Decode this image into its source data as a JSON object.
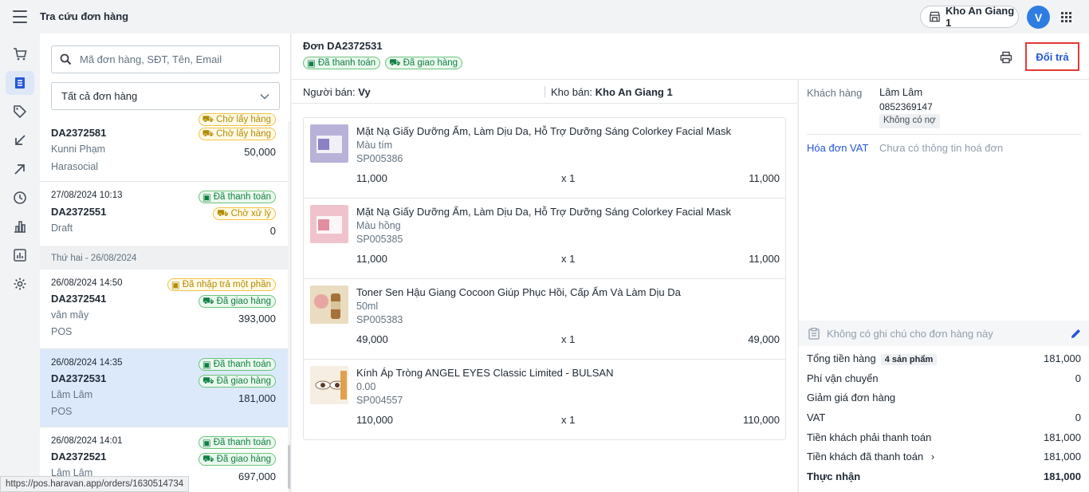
{
  "app": {
    "title": "Tra cứu đơn hàng",
    "store": "Kho An Giang 1",
    "avatar_initial": "V"
  },
  "nav": [
    "cart-icon",
    "orders-icon",
    "tag-icon",
    "import-icon",
    "export-icon",
    "history-icon",
    "chart-icon",
    "report-icon",
    "settings-icon"
  ],
  "list": {
    "search_placeholder": "Mã đơn hàng, SĐT, Tên, Email",
    "filter": "Tất cả đơn hàng",
    "orders": [
      {
        "time": "",
        "code": "DA2372581",
        "customer": "Kunni Phạm",
        "source": "Harasocial",
        "amount": "50,000",
        "badges": [
          {
            "text": "Chờ lấy hàng",
            "color": "yellow",
            "icon": "truck"
          }
        ]
      },
      {
        "time": "27/08/2024 10:13",
        "code": "DA2372551",
        "customer": "",
        "source": "Draft",
        "amount": "0",
        "badges": [
          {
            "text": "Đã thanh toán",
            "color": "green",
            "icon": "cash"
          },
          {
            "text": "Chờ xử lý",
            "color": "yellow",
            "icon": "truck"
          }
        ]
      },
      {
        "time": "26/08/2024 14:50",
        "code": "DA2372541",
        "customer": "vân mây",
        "source": "POS",
        "amount": "393,000",
        "badges": [
          {
            "text": "Đã nhập trả một phần",
            "color": "yellow",
            "icon": "cash"
          },
          {
            "text": "Đã giao hàng",
            "color": "green",
            "icon": "truck"
          }
        ]
      },
      {
        "time": "26/08/2024 14:35",
        "code": "DA2372531",
        "customer": "Lâm Lâm",
        "source": "POS",
        "amount": "181,000",
        "badges": [
          {
            "text": "Đã thanh toán",
            "color": "green",
            "icon": "cash"
          },
          {
            "text": "Đã giao hàng",
            "color": "green",
            "icon": "truck"
          }
        ]
      },
      {
        "time": "26/08/2024 14:01",
        "code": "DA2372521",
        "customer": "Lâm Lâm",
        "source": "",
        "amount": "697,000",
        "badges": [
          {
            "text": "Đã thanh toán",
            "color": "green",
            "icon": "cash"
          },
          {
            "text": "Đã giao hàng",
            "color": "green",
            "icon": "truck"
          }
        ]
      }
    ],
    "day_separator": "Thứ hai - 26/08/2024",
    "status_url": "https://pos.haravan.app/orders/1630514734"
  },
  "order": {
    "title": "Đơn DA2372531",
    "badges": [
      {
        "text": "Đã thanh toán",
        "icon": "cash"
      },
      {
        "text": "Đã giao hàng",
        "icon": "truck"
      }
    ],
    "return_button": "Đổi trả",
    "seller_label": "Người bán:",
    "seller": "Vy",
    "warehouse_label": "Kho bán:",
    "warehouse": "Kho An Giang 1",
    "lines": [
      {
        "name": "Mặt Nạ Giấy Dưỡng Ẩm, Làm Dịu Da, Hỗ Trợ Dưỡng Sáng Colorkey Facial Mask",
        "variant": "Màu tím",
        "sku": "SP005386",
        "price": "11,000",
        "qty": "x 1",
        "total": "11,000",
        "thumb_color": "#b9b2d8"
      },
      {
        "name": "Mặt Nạ Giấy Dưỡng Ẩm, Làm Dịu Da, Hỗ Trợ Dưỡng Sáng Colorkey Facial Mask",
        "variant": "Màu hồng",
        "sku": "SP005385",
        "price": "11,000",
        "qty": "x 1",
        "total": "11,000",
        "thumb_color": "#f0c3cc"
      },
      {
        "name": "Toner Sen Hậu Giang Cocoon Giúp Phục Hồi, Cấp Ẩm Và Làm Dịu Da",
        "variant": "50ml",
        "sku": "SP005383",
        "price": "49,000",
        "qty": "x 1",
        "total": "49,000",
        "thumb_color": "#d9c39a"
      },
      {
        "name": "Kính Áp Tròng ANGEL EYES Classic Limited - BULSAN",
        "variant": "0.00",
        "sku": "SP004557",
        "price": "110,000",
        "qty": "x 1",
        "total": "110,000",
        "thumb_color": "#e9d4b5"
      }
    ]
  },
  "customer": {
    "label": "Khách hàng",
    "name": "Lâm Lâm",
    "phone": "0852369147",
    "debt": "Không có nợ",
    "vat_label": "Hóa đơn VAT",
    "vat_value": "Chưa có thông tin hoá đơn"
  },
  "summary": {
    "note": "Không có ghi chú cho đơn hàng này",
    "subtotal_label": "Tổng tiền hàng",
    "item_count": "4 sản phẩm",
    "subtotal": "181,000",
    "shipping_label": "Phí vận chuyển",
    "shipping": "0",
    "discount_label": "Giảm giá đơn hàng",
    "vat_label": "VAT",
    "vat": "0",
    "due_label": "Tiền khách phải thanh toán",
    "due": "181,000",
    "paid_label": "Tiền khách đã thanh toán",
    "paid": "181,000",
    "net_label": "Thực nhận",
    "net": "181,000"
  }
}
